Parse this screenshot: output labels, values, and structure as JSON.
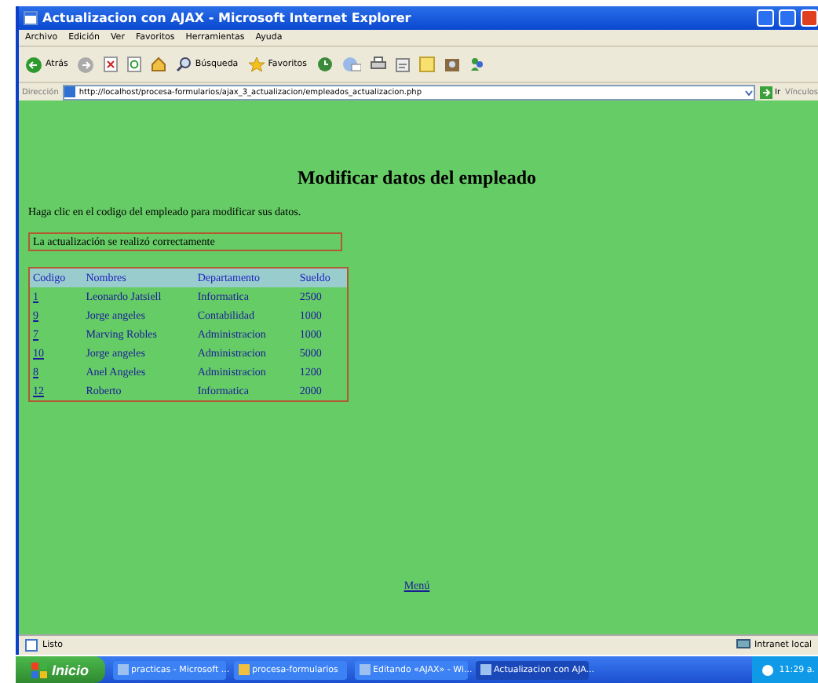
{
  "window": {
    "title": "Actualizacion con AJAX - Microsoft Internet Explorer"
  },
  "menu": [
    "Archivo",
    "Edición",
    "Ver",
    "Favoritos",
    "Herramientas",
    "Ayuda"
  ],
  "toolbar": {
    "back": "Atrás",
    "search": "Búsqueda",
    "favorites": "Favoritos"
  },
  "address": {
    "label": "Dirección",
    "value": "http://localhost/procesa-formularios/ajax_3_actualizacion/empleados_actualizacion.php",
    "go": "Ir",
    "links": "Vínculos"
  },
  "page": {
    "heading": "Modificar datos del empleado",
    "instruction": "Haga clic en el codigo del empleado para modificar sus datos.",
    "message": "La actualización se realizó correctamente",
    "table": {
      "columns": [
        "Codigo",
        "Nombres",
        "Departamento",
        "Sueldo"
      ],
      "rows": [
        [
          "1",
          "Leonardo Jatsiell",
          "Informatica",
          "2500"
        ],
        [
          "9",
          "Jorge angeles",
          "Contabilidad",
          "1000"
        ],
        [
          "7",
          "Marving Robles",
          "Administracion",
          "1000"
        ],
        [
          "10",
          "Jorge angeles",
          "Administracion",
          "5000"
        ],
        [
          "8",
          "Anel Angeles",
          "Administracion",
          "1200"
        ],
        [
          "12",
          "Roberto",
          "Informatica",
          "2000"
        ]
      ]
    },
    "menu_link": "Menú"
  },
  "status_bar": {
    "text": "Listo",
    "zone": "Intranet local"
  },
  "taskbar": {
    "start": "Inicio",
    "tasks": [
      {
        "label": "practicas - Microsoft ...",
        "selected": false
      },
      {
        "label": "procesa-formularios",
        "selected": false
      },
      {
        "label": "Editando «AJAX» - Wi...",
        "selected": false
      },
      {
        "label": "Actualizacion con AJA...",
        "selected": true
      }
    ],
    "clock": "11:29 a."
  }
}
